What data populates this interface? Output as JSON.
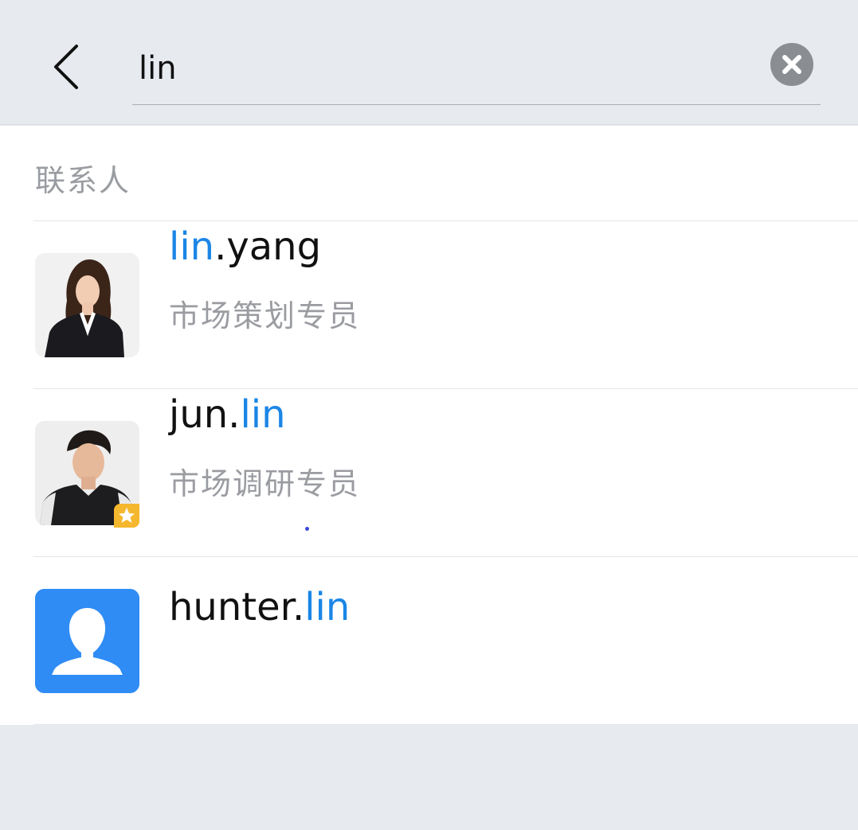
{
  "search": {
    "query": "lin"
  },
  "section": {
    "label": "联系人"
  },
  "contacts": [
    {
      "name_parts": [
        {
          "text": "lin",
          "highlight": true
        },
        {
          "text": ".yang",
          "highlight": false
        }
      ],
      "title": "市场策划专员",
      "avatar": "photo-woman",
      "badge": null
    },
    {
      "name_parts": [
        {
          "text": "jun.",
          "highlight": false
        },
        {
          "text": "lin",
          "highlight": true
        }
      ],
      "title": "市场调研专员",
      "avatar": "photo-man",
      "badge": "star-icon"
    },
    {
      "name_parts": [
        {
          "text": "hunter.",
          "highlight": false
        },
        {
          "text": "lin",
          "highlight": true
        }
      ],
      "title": "",
      "avatar": "default-user-icon",
      "badge": null
    }
  ],
  "colors": {
    "highlight": "#1b86e6",
    "default_avatar_bg": "#2f8cf5",
    "badge": "#f5b72d",
    "background": "#e7eaef"
  }
}
